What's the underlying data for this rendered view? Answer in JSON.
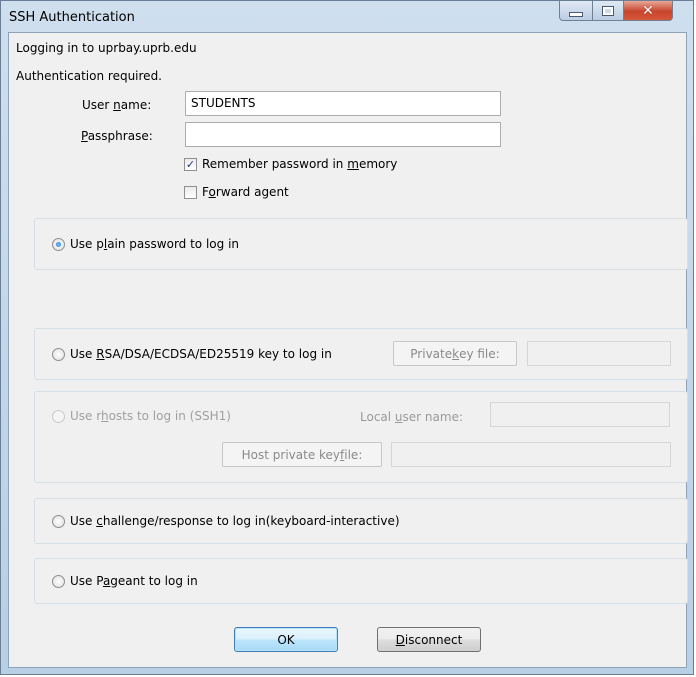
{
  "window": {
    "title": "SSH Authentication"
  },
  "info": {
    "login_line": "Logging in to uprbay.uprb.edu",
    "auth_line": "Authentication required."
  },
  "fields": {
    "username_label_pre": "User ",
    "username_label_u": "n",
    "username_label_post": "ame:",
    "username_value": "STUDENTS",
    "passphrase_label_u": "P",
    "passphrase_label_post": "assphrase:",
    "passphrase_value": ""
  },
  "checkboxes": {
    "remember": {
      "pre": "Remember password in ",
      "u": "m",
      "post": "emory",
      "checked": true
    },
    "forward": {
      "pre": "F",
      "u": "o",
      "post": "rward agent",
      "checked": false
    }
  },
  "options": {
    "plain": {
      "pre": "Use p",
      "u": "l",
      "post": "ain password to log in",
      "selected": true
    },
    "rsa": {
      "pre": "Use ",
      "u": "R",
      "post": "SA/DSA/ECDSA/ED25519 key to log in",
      "selected": false,
      "file_btn_pre": "Private ",
      "file_btn_u": "k",
      "file_btn_post": "ey file:",
      "file_value": ""
    },
    "rhosts": {
      "pre": "Use r",
      "u": "h",
      "post": "osts to log in (SSH1)",
      "selected": false,
      "local_user_pre": "Local ",
      "local_user_u": "u",
      "local_user_post": "ser name:",
      "local_user_value": "",
      "host_btn_pre": "Host private key ",
      "host_btn_u": "f",
      "host_btn_post": "ile:",
      "host_key_value": ""
    },
    "challenge": {
      "pre": "Use ",
      "u": "c",
      "post": "hallenge/response to log in(keyboard-interactive)",
      "selected": false
    },
    "pageant": {
      "pre": "Use P",
      "u": "a",
      "post": "geant to log in",
      "selected": false
    }
  },
  "buttons": {
    "ok": "OK",
    "disconnect_u": "D",
    "disconnect_post": "isconnect"
  }
}
